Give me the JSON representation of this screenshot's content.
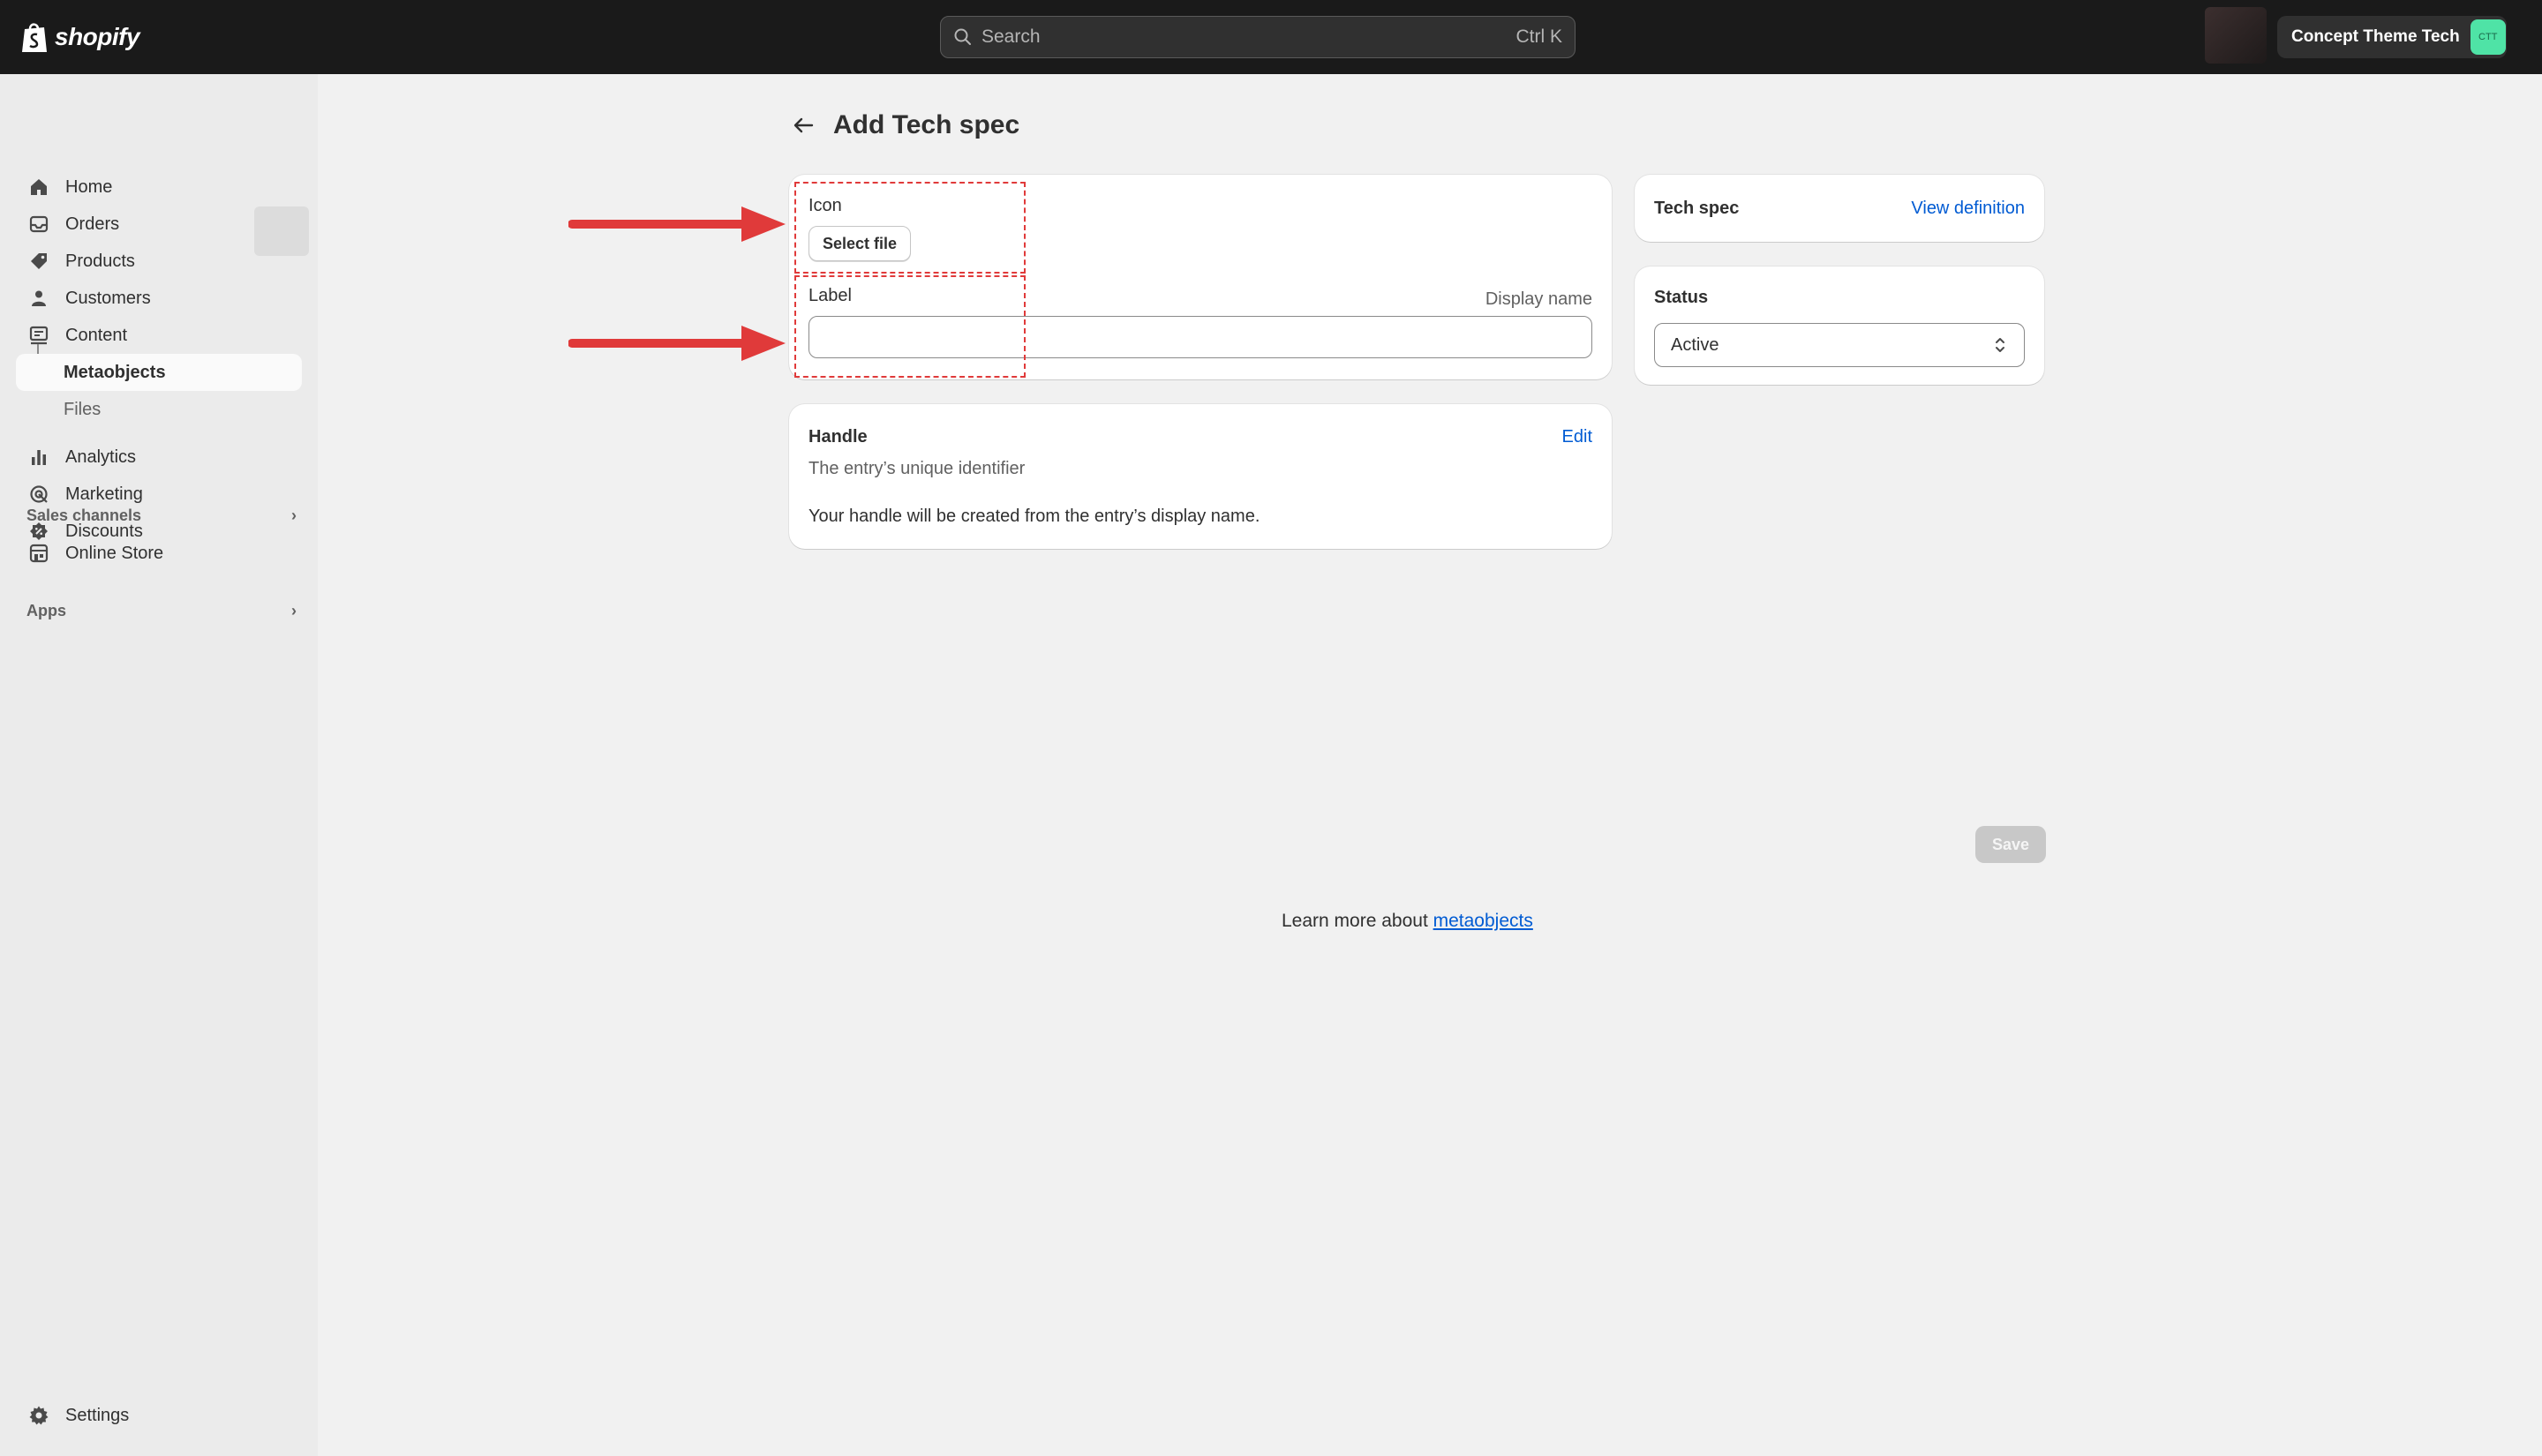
{
  "topbar": {
    "logo_text": "shopify",
    "search_placeholder": "Search",
    "search_shortcut": "Ctrl K",
    "store_name": "Concept Theme Tech",
    "store_initials": "CTT"
  },
  "sidebar": {
    "items": [
      {
        "label": "Home",
        "icon": "home-icon"
      },
      {
        "label": "Orders",
        "icon": "inbox-icon"
      },
      {
        "label": "Products",
        "icon": "tag-icon"
      },
      {
        "label": "Customers",
        "icon": "person-icon"
      },
      {
        "label": "Content",
        "icon": "content-icon"
      },
      {
        "label": "Metaobjects",
        "icon": null
      },
      {
        "label": "Files",
        "icon": null
      },
      {
        "label": "Analytics",
        "icon": "bar-chart-icon"
      },
      {
        "label": "Marketing",
        "icon": "target-icon"
      },
      {
        "label": "Discounts",
        "icon": "discount-icon"
      }
    ],
    "sales_channels_label": "Sales channels",
    "online_store_label": "Online Store",
    "apps_label": "Apps",
    "settings_label": "Settings"
  },
  "page": {
    "title": "Add Tech spec"
  },
  "fields_card": {
    "icon_label": "Icon",
    "select_file_label": "Select file",
    "label_label": "Label",
    "display_name_hint": "Display name",
    "label_value": ""
  },
  "handle_card": {
    "title": "Handle",
    "edit_label": "Edit",
    "subtitle": "The entry’s unique identifier",
    "description": "Your handle will be created from the entry’s display name."
  },
  "techspec_card": {
    "title": "Tech spec",
    "view_definition_label": "View definition"
  },
  "status_card": {
    "title": "Status",
    "selected": "Active"
  },
  "footer": {
    "save_label": "Save",
    "learn_text": "Learn more about ",
    "learn_link": "metaobjects"
  },
  "colors": {
    "topbar_bg": "#1a1a1a",
    "link": "#005bd3",
    "annotation": "#e03a3a",
    "store_avatar": "#4fe3a6"
  }
}
